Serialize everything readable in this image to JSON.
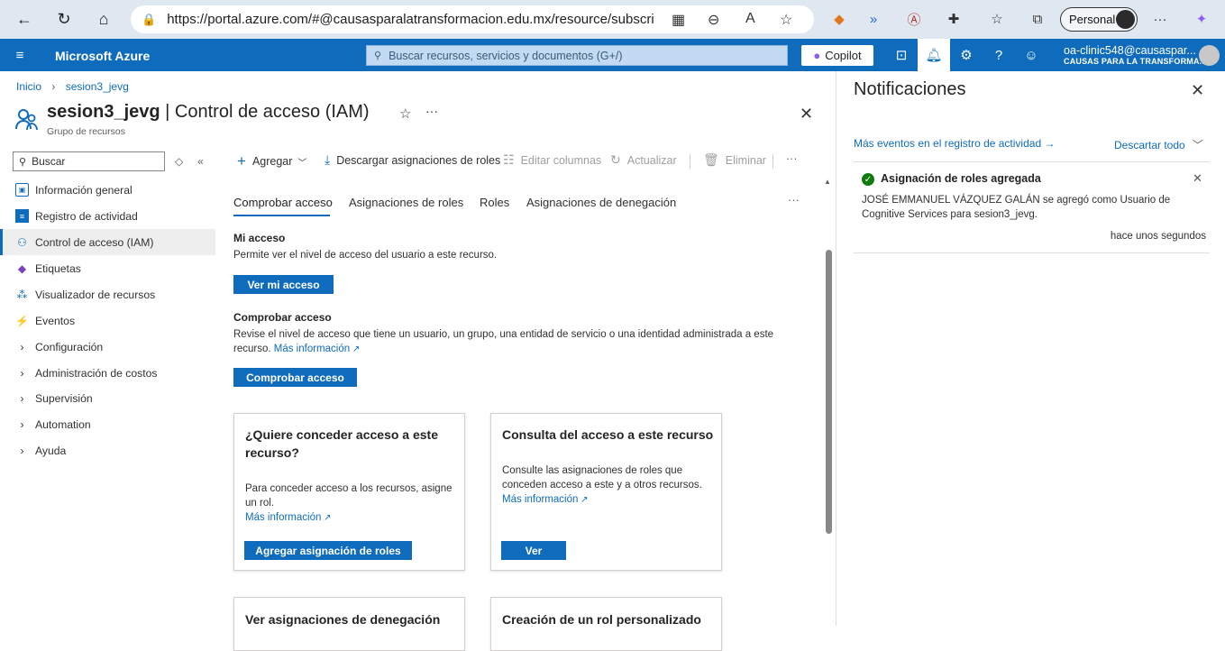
{
  "browser": {
    "url": "https://portal.azure.com/#@causasparalatransformacion.edu.mx/resource/subscripti...",
    "profile": "Personal"
  },
  "azure": {
    "brand": "Microsoft Azure",
    "search_placeholder": "Buscar recursos, servicios y documentos (G+/)",
    "copilot": "Copilot",
    "account_email": "oa-clinic548@causaspar...",
    "account_org": "CAUSAS PARA LA TRANSFORMA..."
  },
  "breadcrumb": {
    "home": "Inicio",
    "resource": "sesion3_jevg"
  },
  "page": {
    "title_resource": "sesion3_jevg",
    "title_section": " | Control de acceso (IAM)",
    "subtitle": "Grupo de recursos"
  },
  "sidebar": {
    "search": "Buscar",
    "items": [
      {
        "label": "Información general",
        "icon": "overview-icon"
      },
      {
        "label": "Registro de actividad",
        "icon": "activity-log-icon"
      },
      {
        "label": "Control de acceso (IAM)",
        "icon": "iam-icon",
        "selected": true
      },
      {
        "label": "Etiquetas",
        "icon": "tag-icon"
      },
      {
        "label": "Visualizador de recursos",
        "icon": "resource-visualizer-icon"
      },
      {
        "label": "Eventos",
        "icon": "events-icon"
      },
      {
        "label": "Configuración",
        "icon": "chevron-right-icon"
      },
      {
        "label": "Administración de costos",
        "icon": "chevron-right-icon"
      },
      {
        "label": "Supervisión",
        "icon": "chevron-right-icon"
      },
      {
        "label": "Automation",
        "icon": "chevron-right-icon"
      },
      {
        "label": "Ayuda",
        "icon": "chevron-right-icon"
      }
    ]
  },
  "commands": {
    "add": "Agregar",
    "download": "Descargar asignaciones de roles",
    "edit_columns": "Editar columnas",
    "refresh": "Actualizar",
    "delete": "Eliminar"
  },
  "tabs": [
    "Comprobar acceso",
    "Asignaciones de roles",
    "Roles",
    "Asignaciones de denegación"
  ],
  "my_access": {
    "title": "Mi acceso",
    "desc": "Permite ver el nivel de acceso del usuario a este recurso.",
    "button": "Ver mi acceso"
  },
  "check_access": {
    "title": "Comprobar acceso",
    "desc": "Revise el nivel de acceso que tiene un usuario, un grupo, una entidad de servicio o una identidad administrada a este",
    "desc2": "recurso.",
    "link": "Más información",
    "button": "Comprobar acceso"
  },
  "cards": [
    {
      "title1": "¿Quiere conceder acceso a este",
      "title2": "recurso?",
      "body1": "Para conceder acceso a los recursos, asigne",
      "body2": "un rol.",
      "link": "Más información",
      "button": "Agregar asignación de roles"
    },
    {
      "title1": "Consulta del acceso a este recurso",
      "body1": "Consulte las asignaciones de roles que",
      "body2": "conceden acceso a este y a otros recursos.",
      "link": "Más información",
      "button": "Ver"
    },
    {
      "title1": "Ver asignaciones de denegación"
    },
    {
      "title1": "Creación de un rol personalizado"
    }
  ],
  "notifications": {
    "title": "Notificaciones",
    "more_events": "Más eventos en el registro de actividad →",
    "dismiss": "Descartar todo",
    "item": {
      "title": "Asignación de roles agregada",
      "body1": "JOSÉ EMMANUEL VÁZQUEZ GALÁN se agregó como Usuario de",
      "body2": "Cognitive Services para sesion3_jevg.",
      "time": "hace unos segundos"
    }
  }
}
